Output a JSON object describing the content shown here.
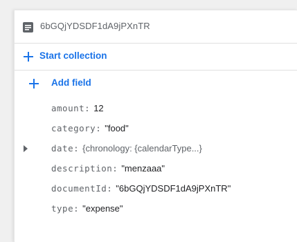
{
  "document": {
    "id_label": "6bGQjYDSDF1dA9jPXnTR"
  },
  "actions": {
    "start_collection_label": "Start collection",
    "add_field_label": "Add field"
  },
  "fields": [
    {
      "key": "amount:",
      "value": "12"
    },
    {
      "key": "category:",
      "value": "\"food\""
    },
    {
      "key": "date:",
      "value": "{chronology: {calendarType...}"
    },
    {
      "key": "description:",
      "value": "\"menzaaa\""
    },
    {
      "key": "documentId:",
      "value": "\"6bGQjYDSDF1dA9jPXnTR\""
    },
    {
      "key": "type:",
      "value": "\"expense\""
    }
  ],
  "icons": {
    "document": "document-icon",
    "plus": "plus-icon",
    "expand": "triangle-right-icon"
  },
  "colors": {
    "accent": "#1a73e8",
    "key_text": "#5f6368",
    "value_text": "#202124",
    "divider": "#e0e0e0"
  }
}
